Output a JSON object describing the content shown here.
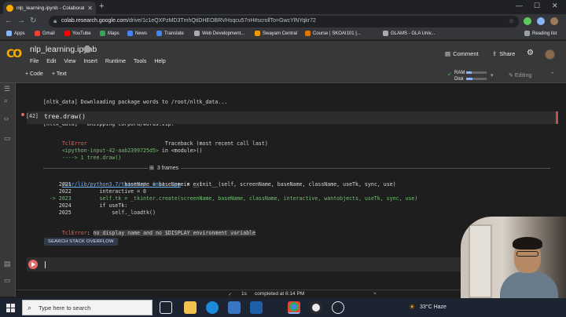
{
  "browser": {
    "tab_title": "nlp_learning.ipynb - Colaborato",
    "url_domain": "colab.research.google.com",
    "url_path": "/drive/1c1eQXPzMD3TmhQtiDHEOBRVHsqcu57nH#scrollTo=GwcYlNYqkr72",
    "bookmarks": [
      "Apps",
      "Gmail",
      "YouTube",
      "Maps",
      "News",
      "Translate",
      "Web Development...",
      "Swayam Central",
      "Course | SKOAI101 |...",
      "GLAMS - GLA Univ..."
    ],
    "reading_list": "Reading list"
  },
  "colab": {
    "logo": "CO",
    "notebook_title": "nlp_learning.ipynb",
    "menu": [
      "File",
      "Edit",
      "View",
      "Insert",
      "Runtime",
      "Tools",
      "Help"
    ],
    "comment_label": "Comment",
    "share_label": "Share",
    "add_code": "+ Code",
    "add_text": "+ Text",
    "ram_label": "RAM",
    "disk_label": "Disk",
    "ram_fill": 0.25,
    "disk_fill": 0.3,
    "editing_label": "Editing"
  },
  "notebook": {
    "prev_output": [
      "[nltk_data] Downloading package words to /root/nltk_data...",
      "[nltk_data]   Unzipping corpora/words.zip."
    ],
    "exec_count": "[42]",
    "code": "tree.draw()",
    "tb_error_name": "TclError",
    "tb_header_right": "Traceback (most recent call last)",
    "tb_input_link": "<ipython-input-42-aab2399725d5>",
    "tb_in_module": " in <module>()",
    "tb_arrow_line": "----> 1 tree.draw()",
    "frames_label": "3 frames",
    "tb_file_link": "/usr/lib/python3.7/tkinter/__init__.py",
    "tb_file_rest": " in __init__(self, screenName, baseName, className, useTk, sync, use)",
    "tb_lines": [
      "     2021                 baseName = baseName + ext",
      "     2022         interactive = 0",
      "  -> 2023         self.tk = _tkinter.create(screenName, baseName, className, interactive, wantobjects, useTk, sync, use)",
      "     2024         if useTk:",
      "     2025             self._loadtk()"
    ],
    "final_error_name": "TclError",
    "final_error_msg": "no display name and no $DISPLAY environment variable",
    "search_btn": "SEARCH STACK OVERFLOW"
  },
  "status": {
    "check": "✓",
    "duration": "1s",
    "completed": "completed at 6:14 PM",
    "close": "×"
  },
  "taskbar": {
    "search_placeholder": "Type here to search",
    "weather": "33°C Haze",
    "icons": [
      "task-view",
      "file-explorer",
      "edge",
      "store",
      "mail",
      "chrome",
      "obs",
      "settings"
    ]
  },
  "colors": {
    "accent": "#f9ab00",
    "error": "#e06c6c",
    "link": "#6cb6ff",
    "ok": "#5ec95e"
  }
}
